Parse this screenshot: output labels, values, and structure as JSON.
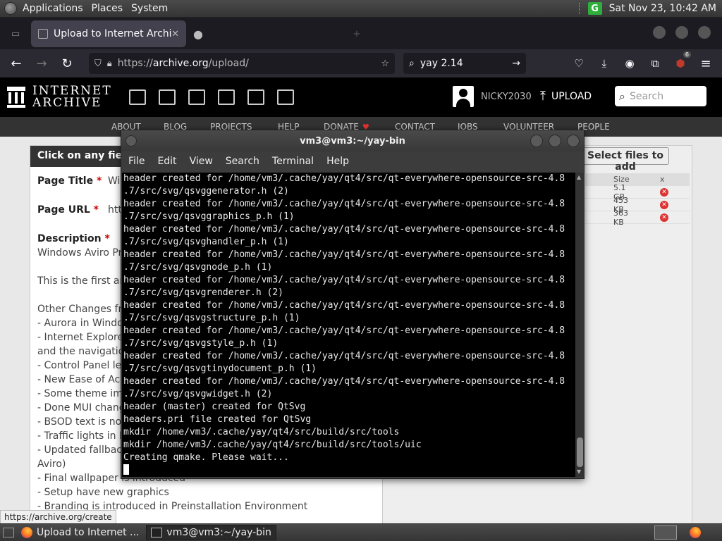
{
  "top_panel": {
    "menus": [
      "Applications",
      "Places",
      "System"
    ],
    "clock": "Sat Nov 23, 10:42 AM",
    "tray_icon": "G"
  },
  "firefox": {
    "tabs": [
      {
        "label": "Upload to Internet Archive",
        "active": true
      },
      {
        "label": "",
        "active": false
      }
    ],
    "url_scheme": "https://",
    "url_domain": "archive.org",
    "url_path": "/upload/",
    "search_value": "yay 2.14",
    "extension_badge": "6"
  },
  "archive": {
    "logo_line1": "INTERNET",
    "logo_line2": "ARCHIVE",
    "username": "NICKY2030",
    "upload_label": "UPLOAD",
    "search_placeholder": "Search",
    "nav": [
      "ABOUT",
      "BLOG",
      "PROJECTS",
      "HELP",
      "DONATE",
      "CONTACT",
      "JOBS",
      "VOLUNTEER",
      "PEOPLE"
    ]
  },
  "upload_form": {
    "header": "Click on any field",
    "page_title_label": "Page Title",
    "page_title_value": "Wi",
    "page_url_label": "Page URL",
    "page_url_value": "htt",
    "description_label": "Description",
    "description_lines": [
      "Windows Aviro Pre",
      "",
      "This is the first and",
      "",
      "Other Changes fro",
      "- Aurora in Window",
      "- Internet Explorer",
      "and the navigation",
      "- Control Panel left",
      "- New Ease of Acc",
      "- Some theme impr",
      "- Done MUI change",
      "- BSOD text is now",
      "- Traffic lights in Di",
      "- Updated fallback",
      "Aviro)",
      "- Final wallpaper is introduced",
      "- Setup have new graphics",
      "- Branding is introduced in Preinstallation Environment"
    ],
    "select_files_label": "Select files to add",
    "file_table": {
      "headers": [
        "Size",
        "x"
      ],
      "rows": [
        {
          "size": "5.1 GB"
        },
        {
          "size": "453 KB"
        },
        {
          "size": "363 KB"
        }
      ]
    }
  },
  "status_url": "https://archive.org/create",
  "terminal": {
    "title": "vm3@vm3:~/yay-bin",
    "menu": [
      "File",
      "Edit",
      "View",
      "Search",
      "Terminal",
      "Help"
    ],
    "lines": [
      "header created for /home/vm3/.cache/yay/qt4/src/qt-everywhere-opensource-src-4.8",
      ".7/src/svg/qsvggenerator.h (2)",
      "header created for /home/vm3/.cache/yay/qt4/src/qt-everywhere-opensource-src-4.8",
      ".7/src/svg/qsvggraphics_p.h (1)",
      "header created for /home/vm3/.cache/yay/qt4/src/qt-everywhere-opensource-src-4.8",
      ".7/src/svg/qsvghandler_p.h (1)",
      "header created for /home/vm3/.cache/yay/qt4/src/qt-everywhere-opensource-src-4.8",
      ".7/src/svg/qsvgnode_p.h (1)",
      "header created for /home/vm3/.cache/yay/qt4/src/qt-everywhere-opensource-src-4.8",
      ".7/src/svg/qsvgrenderer.h (2)",
      "header created for /home/vm3/.cache/yay/qt4/src/qt-everywhere-opensource-src-4.8",
      ".7/src/svg/qsvgstructure_p.h (1)",
      "header created for /home/vm3/.cache/yay/qt4/src/qt-everywhere-opensource-src-4.8",
      ".7/src/svg/qsvgstyle_p.h (1)",
      "header created for /home/vm3/.cache/yay/qt4/src/qt-everywhere-opensource-src-4.8",
      ".7/src/svg/qsvgtinydocument_p.h (1)",
      "header created for /home/vm3/.cache/yay/qt4/src/qt-everywhere-opensource-src-4.8",
      ".7/src/svg/qsvgwidget.h (2)",
      "header (master) created for QtSvg",
      "headers.pri file created for QtSvg",
      "mkdir /home/vm3/.cache/yay/qt4/src/build/src/tools",
      "mkdir /home/vm3/.cache/yay/qt4/src/build/src/tools/uic",
      "Creating qmake. Please wait..."
    ]
  },
  "taskbar": {
    "tasks": [
      {
        "label": "Upload to Internet ...",
        "icon": "firefox-icon"
      },
      {
        "label": "vm3@vm3:~/yay-bin",
        "icon": "terminal-icon"
      }
    ]
  }
}
